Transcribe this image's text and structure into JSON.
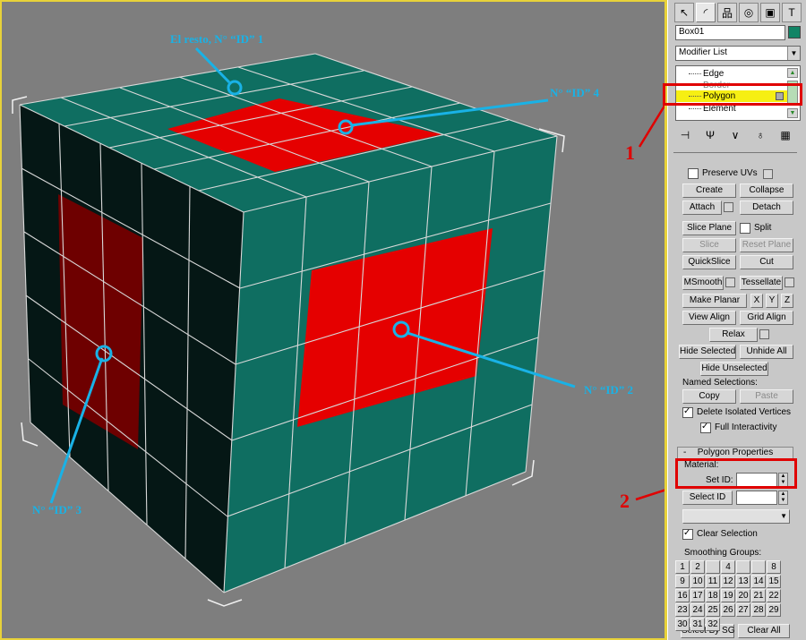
{
  "viewport": {
    "annotations": [
      "El resto, N° “ID” 1",
      "N° “ID” 4",
      "N° “ID” 2",
      "N° “ID” 3"
    ],
    "markers": [
      "1",
      "2"
    ],
    "colors": {
      "face": "#0f6e61",
      "dark": "#051715",
      "red": "#e50000",
      "darkred": "#6e0000",
      "cyan": "#19b2e6"
    }
  },
  "panel": {
    "toolbar_icons": [
      "cursor-icon",
      "modify-icon",
      "hierarchy-icon",
      "motion-icon",
      "display-icon",
      "utilities-icon"
    ],
    "object_name": "Box01",
    "modifier_list": "Modifier List",
    "stack": [
      "Edge",
      "Border",
      "Polygon",
      "Element"
    ],
    "edit": {
      "preserve_uvs": "Preserve UVs",
      "create": "Create",
      "collapse": "Collapse",
      "attach": "Attach",
      "detach": "Detach",
      "slice_plane": "Slice Plane",
      "split": "Split",
      "slice": "Slice",
      "reset_plane": "Reset Plane",
      "quickslice": "QuickSlice",
      "cut": "Cut",
      "msmooth": "MSmooth",
      "tessellate": "Tessellate",
      "make_planar": "Make Planar",
      "x": "X",
      "y": "Y",
      "z": "Z",
      "view_align": "View Align",
      "grid_align": "Grid Align",
      "relax": "Relax",
      "hide_selected": "Hide Selected",
      "unhide_all": "Unhide All",
      "hide_unselected": "Hide Unselected",
      "named_selections": "Named Selections:",
      "copy": "Copy",
      "paste": "Paste",
      "delete_isolated": "Delete Isolated Vertices",
      "full_interactivity": "Full Interactivity"
    },
    "props": {
      "title": "Polygon Properties",
      "collapse_sign": "-",
      "material": "Material:",
      "set_id": "Set ID:",
      "select_id": "Select ID",
      "clear_selection": "Clear Selection",
      "smoothing_groups": "Smoothing Groups:",
      "sg": [
        "1",
        "2",
        "",
        "4",
        "",
        "",
        "8",
        "9",
        "10",
        "11",
        "12",
        "13",
        "14",
        "15",
        "16",
        "17",
        "18",
        "19",
        "20",
        "21",
        "22",
        "23",
        "24",
        "25",
        "26",
        "27",
        "28",
        "29",
        "30",
        "31",
        "32"
      ],
      "select_by_sg": "Select By SG",
      "clear_all": "Clear All"
    }
  }
}
